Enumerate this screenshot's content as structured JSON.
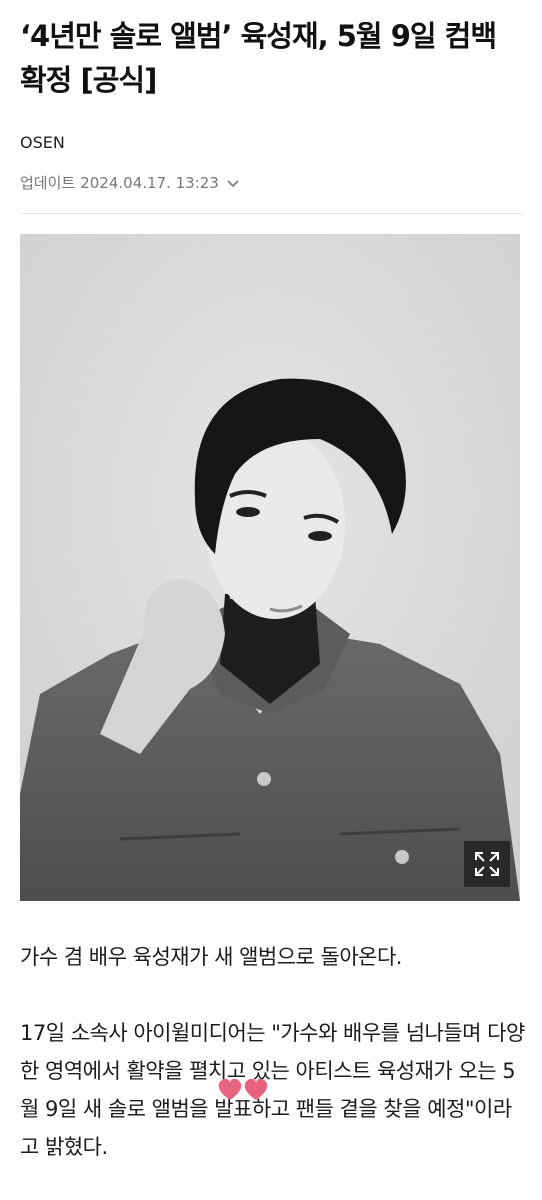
{
  "article": {
    "headline": "‘4년만 솔로 앨범’ 육성재, 5월 9일 컴백 확정 [공식]",
    "press": "OSEN",
    "update_label": "업데이트",
    "update_time": "2024.04.17. 13:23",
    "photo_icon": "expand-icon",
    "paragraphs": [
      "가수 겸 배우 육성재가 새 앨범으로 돌아온다.",
      "17일 소속사 아이윌미디어는 \"가수와 배우를 넘나들며 다양한 영역에서 활약을 펼치고 있는 아티스트 육성재가 오는 5월 9일 새 솔로 앨범을 발표하고 팬들 곁을 찾을 예정\"이라고 밝혔다."
    ]
  },
  "colors": {
    "text": "#111111",
    "meta": "#777777",
    "photo_bg": "#dadada",
    "heart": "#e8637e"
  }
}
